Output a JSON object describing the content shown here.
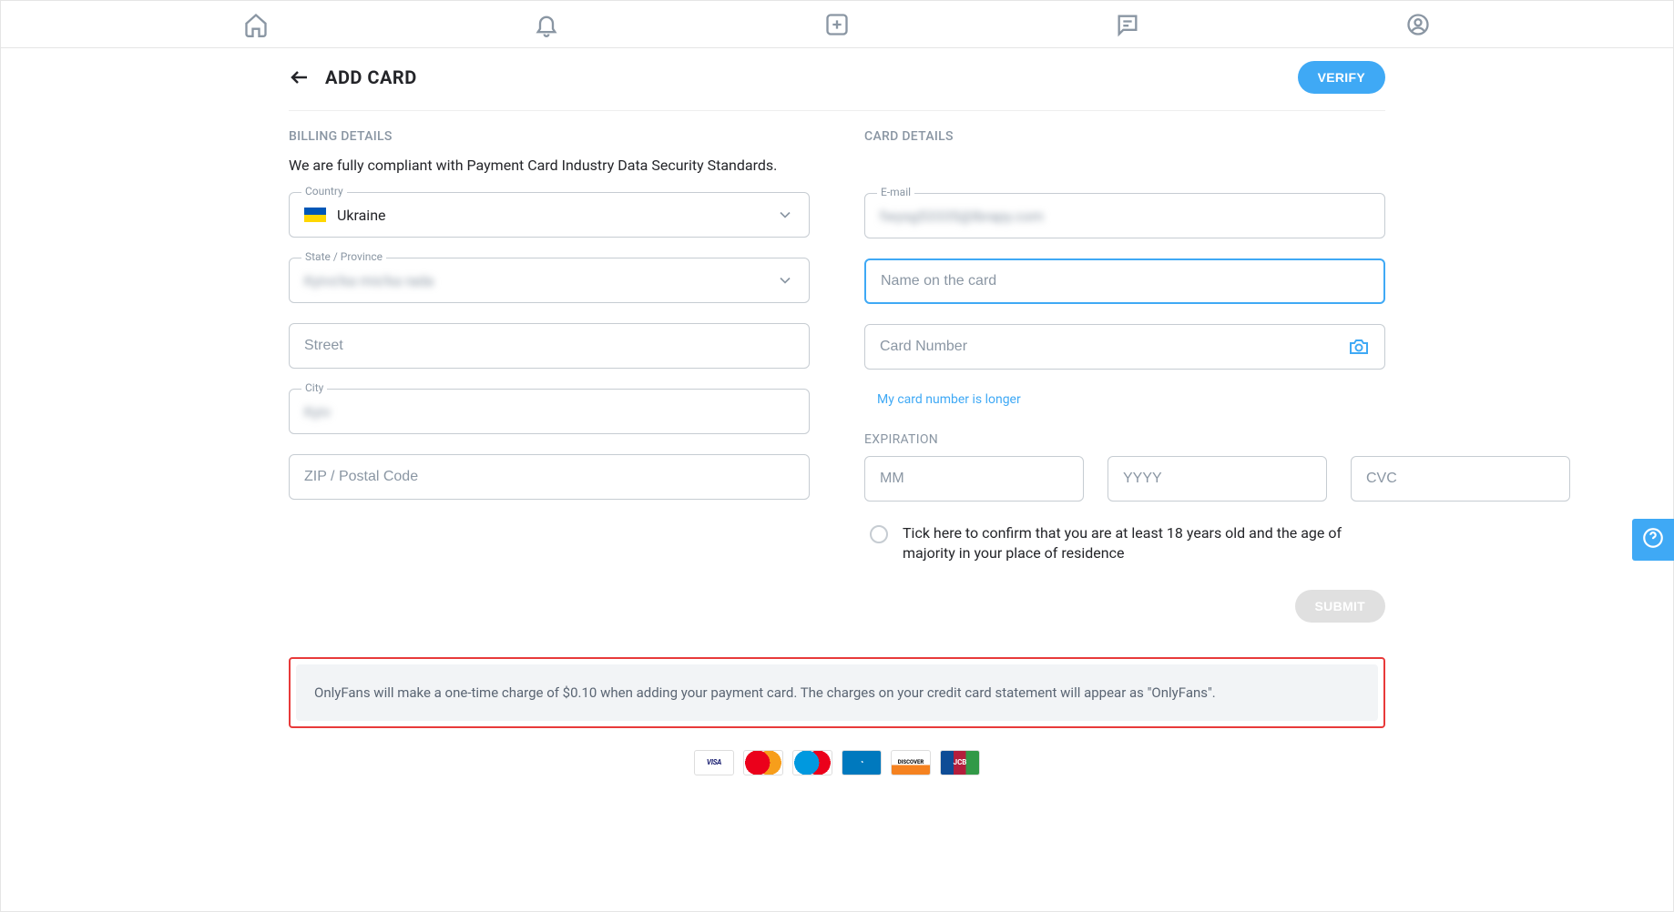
{
  "header": {
    "title": "ADD CARD",
    "verify_btn": "VERIFY"
  },
  "billing": {
    "section_title": "BILLING DETAILS",
    "compliance": "We are fully compliant with Payment Card Industry Data Security Standards.",
    "country_label": "Country",
    "country_value": "Ukraine",
    "state_label": "State / Province",
    "state_value": "Kyivs'ka mis'ka rada",
    "street_placeholder": "Street",
    "city_label": "City",
    "city_value": "Kyiv",
    "zip_placeholder": "ZIP / Postal Code"
  },
  "card": {
    "section_title": "CARD DETAILS",
    "email_label": "E-mail",
    "email_value": "fwysg53335@lbrapy.com",
    "name_placeholder": "Name on the card",
    "number_placeholder": "Card Number",
    "longer_link": "My card number is longer",
    "expiration_label": "EXPIRATION",
    "mm_placeholder": "MM",
    "yyyy_placeholder": "YYYY",
    "cvc_placeholder": "CVC",
    "confirm_text": "Tick here to confirm that you are at least 18 years old and the age of majority in your place of residence",
    "submit_btn": "SUBMIT"
  },
  "notice": "OnlyFans will make a one-time charge of $0.10 when adding your payment card. The charges on your credit card statement will appear as \"OnlyFans\".",
  "logos": [
    "VISA",
    "",
    "",
    "",
    "DISCOVER",
    "JCB"
  ]
}
